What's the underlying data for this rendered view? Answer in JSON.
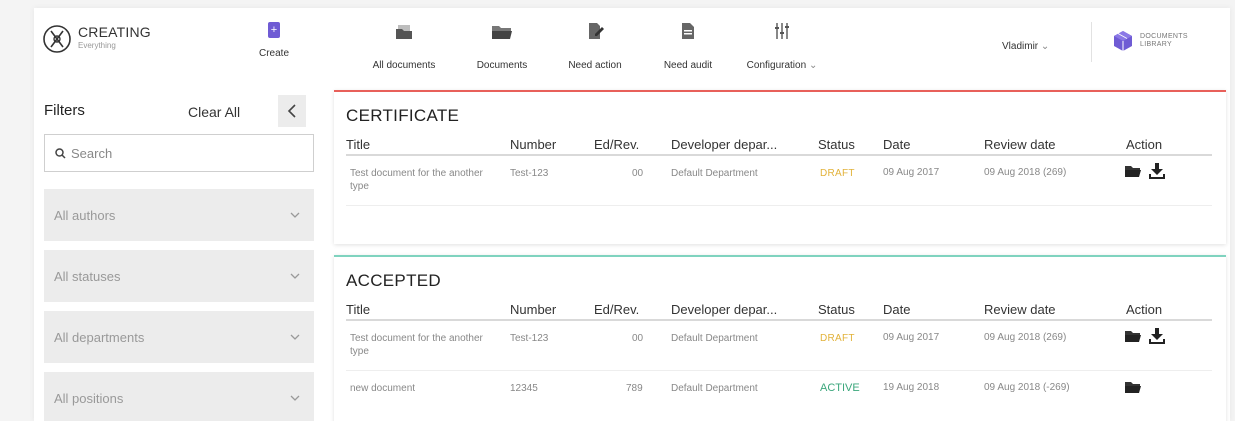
{
  "brand": {
    "title": "CREATING",
    "subtitle": "Everything"
  },
  "header": {
    "create_label": "Create",
    "nav": [
      {
        "label": "All documents",
        "icon": "stack-folder-icon"
      },
      {
        "label": "Documents",
        "icon": "folder-open-icon"
      },
      {
        "label": "Need action",
        "icon": "edit-document-icon"
      },
      {
        "label": "Need audit",
        "icon": "audit-document-icon"
      },
      {
        "label": "Configuration",
        "icon": "sliders-icon",
        "has_dropdown": true
      }
    ],
    "user": "Vladimir",
    "library": {
      "line1": "DOCUMENTS",
      "line2": "LIBRARY"
    }
  },
  "sidebar": {
    "title": "Filters",
    "clear_all": "Clear All",
    "search_placeholder": "Search",
    "filters": [
      {
        "label": "All authors"
      },
      {
        "label": "All statuses"
      },
      {
        "label": "All departments"
      },
      {
        "label": "All positions"
      }
    ]
  },
  "columns": [
    "Title",
    "Number",
    "Ed/Rev.",
    "Developer depar...",
    "Status",
    "Date",
    "Review date",
    "Action"
  ],
  "sections": [
    {
      "name": "CERTIFICATE",
      "rows": [
        {
          "title": "Test document for the another type",
          "number": "Test-123",
          "edrev": "00",
          "department": "Default Department",
          "status": "DRAFT",
          "date": "09 Aug 2017",
          "review": "09 Aug 2018 (269)",
          "actions": [
            "open",
            "download"
          ]
        }
      ]
    },
    {
      "name": "ACCEPTED",
      "rows": [
        {
          "title": "Test document for the another type",
          "number": "Test-123",
          "edrev": "00",
          "department": "Default Department",
          "status": "DRAFT",
          "date": "09 Aug 2017",
          "review": "09 Aug 2018 (269)",
          "actions": [
            "open",
            "download"
          ]
        },
        {
          "title": "new document",
          "number": "12345",
          "edrev": "789",
          "department": "Default Department",
          "status": "ACTIVE",
          "date": "19 Aug 2018",
          "review": "09 Aug 2018 (-269)",
          "actions": [
            "open"
          ]
        }
      ]
    }
  ],
  "colors": {
    "accent": "#6f5bd4",
    "certificate_border": "#e8605a",
    "accepted_border": "#7fd3bf",
    "draft": "#e2b23a",
    "active": "#3ba77c"
  }
}
